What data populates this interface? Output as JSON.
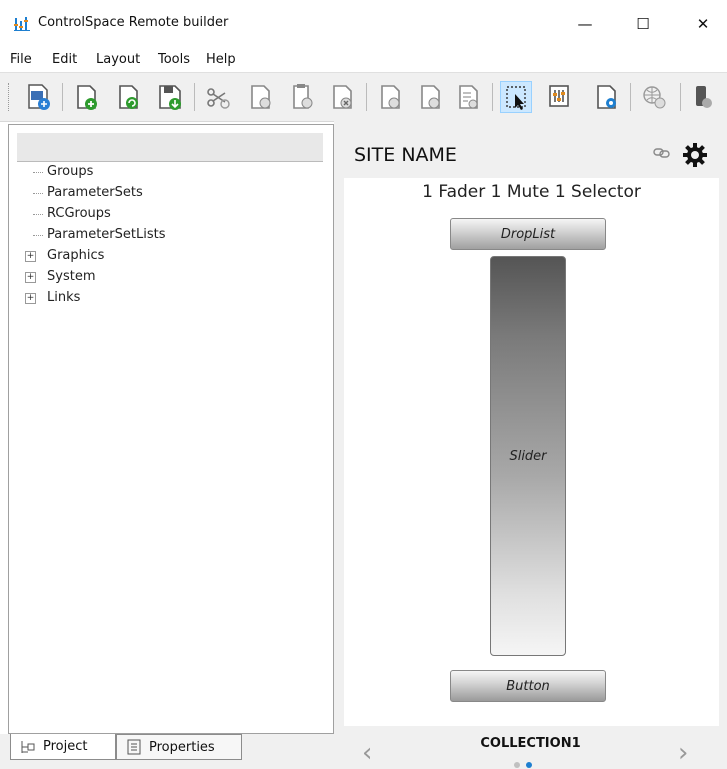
{
  "window": {
    "title": "ControlSpace Remote builder",
    "minimize": "—",
    "maximize": "☐",
    "close": "✕"
  },
  "menu": [
    "File",
    "Edit",
    "Layout",
    "Tools",
    "Help"
  ],
  "tree": {
    "items": [
      {
        "label": "Groups",
        "expandable": false
      },
      {
        "label": "ParameterSets",
        "expandable": false
      },
      {
        "label": "RCGroups",
        "expandable": false
      },
      {
        "label": "ParameterSetLists",
        "expandable": false
      },
      {
        "label": "Graphics",
        "expandable": true
      },
      {
        "label": "System",
        "expandable": true
      },
      {
        "label": "Links",
        "expandable": true
      }
    ],
    "expand_symbol": "+"
  },
  "tabs": {
    "project": "Project",
    "properties": "Properties"
  },
  "right": {
    "site_name": "SITE NAME",
    "screen_title": "1 Fader 1 Mute 1 Selector",
    "droplist_label": "DropList",
    "slider_label": "Slider",
    "button_label": "Button",
    "collection": "COLLECTION1",
    "prev": "‹",
    "next": "›"
  },
  "colors": {
    "accent": "#1e7fd0",
    "selected_tool_bg": "#cce8ff",
    "active_dot": "#1e7fd0",
    "inactive_dot": "#c0c0c0"
  }
}
